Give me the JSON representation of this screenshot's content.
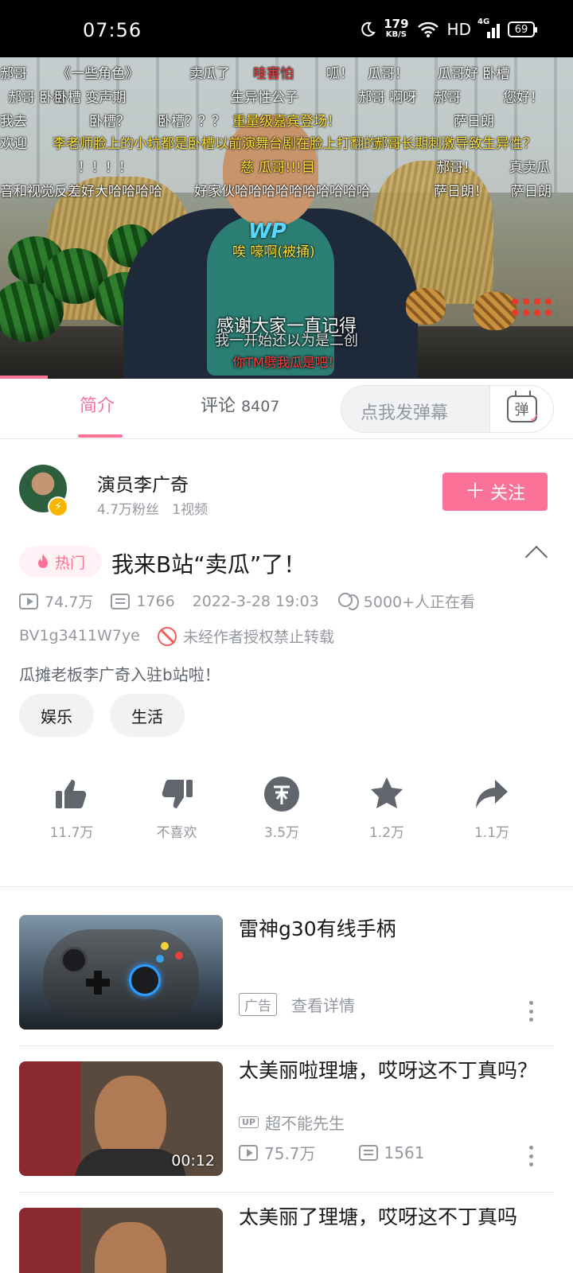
{
  "status_bar": {
    "time": "07:56",
    "net_speed": "179",
    "net_unit": "KB/S",
    "hd": "HD",
    "network": "4G",
    "battery": "69"
  },
  "video": {
    "danmaku": [
      {
        "text": "郝哥",
        "color": "white"
      },
      {
        "text": "《一些角色》",
        "color": "white"
      },
      {
        "text": "卖瓜了",
        "color": "white"
      },
      {
        "text": "哇害怕",
        "color": "red"
      },
      {
        "text": "呱！",
        "color": "white"
      },
      {
        "text": "瓜哥！",
        "color": "white"
      },
      {
        "text": "瓜哥好 卧槽",
        "color": "white"
      },
      {
        "text": "郝哥 卧槽",
        "color": "white"
      },
      {
        "text": "卧槽 变声期",
        "color": "white"
      },
      {
        "text": "生异性公子",
        "color": "white"
      },
      {
        "text": "郝哥 啊呀",
        "color": "white"
      },
      {
        "text": "郝哥",
        "color": "white"
      },
      {
        "text": "您好！",
        "color": "white"
      },
      {
        "text": "我去",
        "color": "white"
      },
      {
        "text": "卧槽？",
        "color": "white"
      },
      {
        "text": "卧槽？？？",
        "color": "white"
      },
      {
        "text": "重量级嘉宾登场！",
        "color": "yellow"
      },
      {
        "text": "萨日朗",
        "color": "white"
      },
      {
        "text": "欢迎",
        "color": "white"
      },
      {
        "text": "李老师脸上的小坑都是卧槽以前演舞台剧在脸上打翻的",
        "color": "yellow"
      },
      {
        "text": "郝哥长期刺激导致生异性？",
        "color": "yellow"
      },
      {
        "text": "！！！！",
        "color": "white"
      },
      {
        "text": "慈 瓜哥!!!目",
        "color": "yellow"
      },
      {
        "text": "郝哥！",
        "color": "white"
      },
      {
        "text": "真卖瓜",
        "color": "white"
      },
      {
        "text": "音和视觉反差好大哈哈哈哈",
        "color": "white"
      },
      {
        "text": "好家伙哈哈哈哈哈哈哈哈哈哈",
        "color": "white"
      },
      {
        "text": "萨日朗！",
        "color": "white"
      },
      {
        "text": "萨日朗",
        "color": "white"
      },
      {
        "text": "唉 嚎啊(被捅)",
        "color": "yellow"
      }
    ],
    "subtitle_main": "感谢大家一直记得",
    "subtitle_secondary": "我一开始还以为是二创",
    "subtitle_red": "你TM劈我瓜是吧！",
    "watermark": "WP"
  },
  "tabs": {
    "intro": "简介",
    "comments_label": "评论",
    "comments_count": "8407",
    "danmu_placeholder": "点我发弹幕",
    "danmu_icon_text": "弹"
  },
  "uploader": {
    "name": "演员李广奇",
    "fans": "4.7万粉丝",
    "videos": "1视频",
    "follow_label": "关注"
  },
  "video_info": {
    "hot_tag": "热门",
    "title": "我来B站“卖瓜”了！",
    "views": "74.7万",
    "danmaku_count": "1766",
    "date": "2022-3-28 19:03",
    "watching": "5000+人正在看",
    "bvid": "BV1g3411W7ye",
    "no_repost": "未经作者授权禁止转载",
    "description": "瓜摊老板李广奇入驻b站啦！",
    "tags": [
      "娱乐",
      "生活"
    ]
  },
  "actions": {
    "like": "11.7万",
    "dislike": "不喜欢",
    "coin": "3.5万",
    "favorite": "1.2万",
    "share": "1.1万"
  },
  "feed": [
    {
      "title": "雷神g30有线手柄",
      "ad_tag": "广告",
      "ad_link": "查看详情"
    },
    {
      "title": "太美丽啦理塘，哎呀这不丁真吗？",
      "up_badge": "UP",
      "author": "超不能先生",
      "views": "75.7万",
      "danmaku": "1561",
      "duration": "00:12"
    },
    {
      "title": "太美丽了理塘，哎呀这不丁真吗"
    }
  ],
  "colors": {
    "accent": "#fb7299",
    "text_primary": "#18191c",
    "text_secondary": "#9499a0",
    "statusbar_bg": "#000000"
  }
}
